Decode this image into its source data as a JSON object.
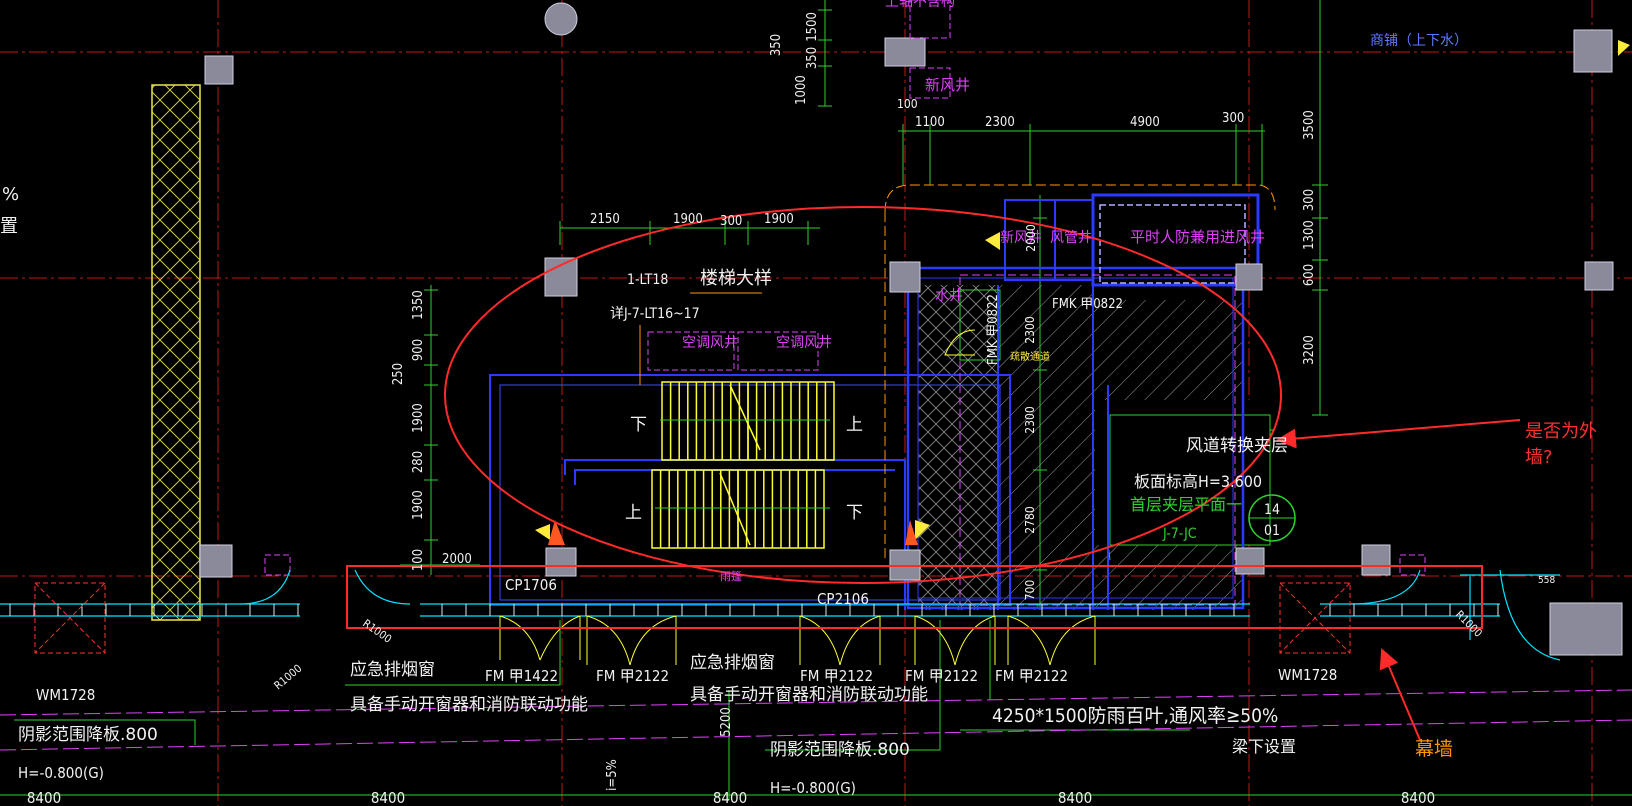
{
  "colors": {
    "background": "#000000",
    "axis": "#ff2020",
    "dim": "#2ed12e",
    "wall": "#2a3aff",
    "wall_light": "#5a7bff",
    "window": "#00e5ff",
    "stair": "#ffff33",
    "magenta": "#e040fb",
    "white": "#f2f2f2",
    "column": "#8a8a9a",
    "markup": "#ff2a2a",
    "hatch": "#a0a0a0",
    "orange_note": "#ff9800",
    "yellow": "#ffeb3b"
  },
  "axis_bottom": {
    "labels": [
      "8400",
      "8400",
      "8400",
      "8400",
      "8400"
    ]
  },
  "dims": {
    "top_vertical": [
      "1500",
      "350",
      "350",
      "1000",
      "100"
    ],
    "top_horizontal": [
      "1100",
      "2300",
      "4900",
      "300"
    ],
    "right_vertical": [
      "3500",
      "300",
      "1300",
      "600",
      "3200"
    ],
    "stair_horizontal": [
      "2150",
      "1900",
      "300",
      "1900"
    ],
    "stair_vertical": [
      "1350",
      "900",
      "250",
      "1900",
      "280",
      "1900",
      "100"
    ],
    "shaft_vertical": [
      "2000",
      "2300",
      "2300",
      "2780",
      "700"
    ],
    "left_2000": "2000",
    "right_558": "558",
    "bottom_5200": "5200",
    "radius_labels": [
      "R1000",
      "R1000",
      "R1000"
    ]
  },
  "labels": {
    "top_magenta_1": "上轴不含构",
    "top_magenta_2": "新风井",
    "top_right_blue": "商铺（上下水）",
    "left_edge_1": "%",
    "left_edge_2": "置",
    "stair_id": "1-LT18",
    "stair_title": "楼梯大样",
    "stair_ref": "详J-7-LT16~17",
    "ac_shaft_1": "空调风井",
    "ac_shaft_2": "空调风井",
    "stair_down_1": "下",
    "stair_up_1": "上",
    "stair_up_2": "上",
    "stair_down_2": "下",
    "shaft_water": "水井",
    "shaft_new_air": "新风井",
    "shaft_smoke": "风管井",
    "shaft_civil_air": "平时人防兼用进风井",
    "fmk_1": "FMK 甲0822",
    "fmk_2": "FMK 甲0822",
    "evac_small": "疏散通道",
    "duct_layer": "风道转换夹层",
    "slab_level": "板面标高H=3.600",
    "mezz_plan": "首层夹层平面一",
    "ref_jc": "J-7-JC",
    "bubble_top": "14",
    "bubble_bottom": "01",
    "cp_1": "CP1706",
    "cp_2": "CP2106",
    "rain_small": "雨篷",
    "fm_1": "FM 甲1422",
    "fm_2": "FM 甲2122",
    "fm_3": "FM 甲2122",
    "fm_4": "FM 甲2122",
    "fm_5": "FM 甲2122",
    "emergency_1": "应急排烟窗",
    "manual_1": "具备手动开窗器和消防联动功能",
    "emergency_2": "应急排烟窗",
    "manual_2": "具备手动开窗器和消防联动功能",
    "louver": "4250*1500防雨百叶,通风率≥50%",
    "beam_under": "梁下设置",
    "wm_1": "WM1728",
    "wm_2": "WM1728",
    "shadow_1": "阴影范围降板.800",
    "shadow_2": "阴影范围降板.800",
    "elev_1": "H=-0.800(G)",
    "elev_2": "H=-0.800(G)",
    "slope": "i=5%"
  },
  "annotations": {
    "question": "是否为外墙?",
    "curtain_wall": "幕墙"
  }
}
